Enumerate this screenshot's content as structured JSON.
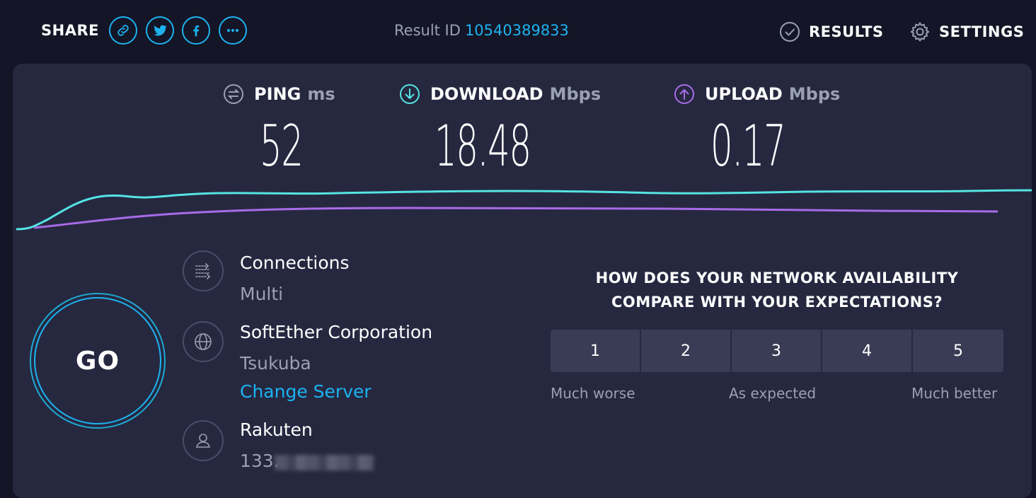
{
  "header": {
    "share_label": "SHARE",
    "share_buttons": [
      "link-icon",
      "twitter-icon",
      "facebook-icon",
      "more-icon"
    ],
    "result_id_label": "Result ID",
    "result_id_value": "10540389833",
    "nav": {
      "results_label": "RESULTS",
      "settings_label": "SETTINGS"
    }
  },
  "metrics": {
    "ping": {
      "label": "PING",
      "unit": "ms",
      "value": "52"
    },
    "download": {
      "label": "DOWNLOAD",
      "unit": "Mbps",
      "value": "18.48"
    },
    "upload": {
      "label": "UPLOAD",
      "unit": "Mbps",
      "value": "0.17"
    }
  },
  "go_label": "GO",
  "connection": {
    "connections_title": "Connections",
    "connections_value": "Multi",
    "server_name": "SoftEther Corporation",
    "server_location": "Tsukuba",
    "change_server_label": "Change Server",
    "isp_name": "Rakuten",
    "ip_prefix": "133."
  },
  "survey": {
    "question_line1": "HOW DOES YOUR NETWORK AVAILABILITY",
    "question_line2": "COMPARE WITH YOUR EXPECTATIONS?",
    "options": [
      "1",
      "2",
      "3",
      "4",
      "5"
    ],
    "low_label": "Much worse",
    "mid_label": "As expected",
    "high_label": "Much better"
  },
  "colors": {
    "background": "#141526",
    "panel": "#262840",
    "accent": "#1cb3f0",
    "download_line": "#54e4e4",
    "upload_line": "#a86be8"
  }
}
